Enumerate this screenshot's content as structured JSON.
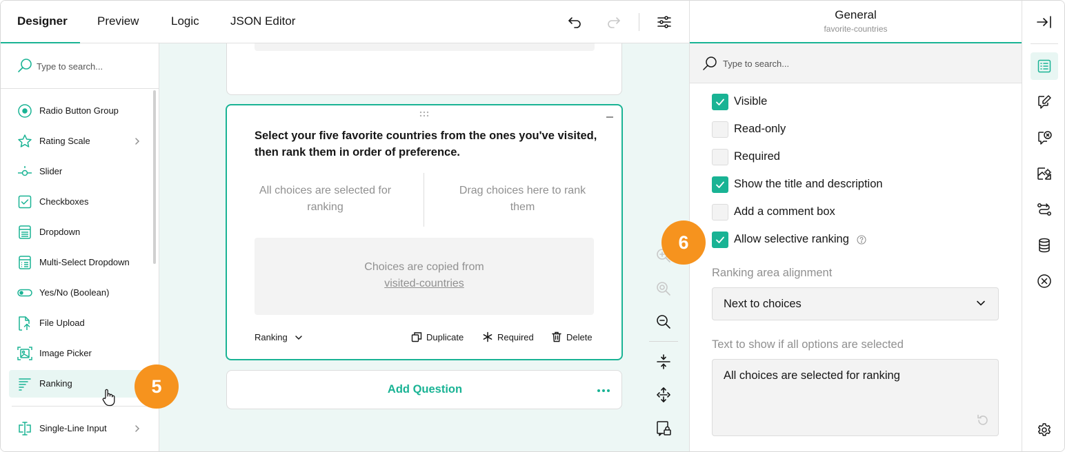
{
  "tabs": [
    {
      "label": "Designer"
    },
    {
      "label": "Preview"
    },
    {
      "label": "Logic"
    },
    {
      "label": "JSON Editor"
    }
  ],
  "toolbar_icons": [
    "undo-icon",
    "redo-icon",
    "settings-sliders-icon"
  ],
  "toolbox": {
    "search_placeholder": "Type to search...",
    "items": [
      {
        "label": "Radio Button Group",
        "icon": "radio-icon"
      },
      {
        "label": "Rating Scale",
        "icon": "star-icon",
        "has_submenu": true
      },
      {
        "label": "Slider",
        "icon": "slider-icon"
      },
      {
        "label": "Checkboxes",
        "icon": "checkbox-icon"
      },
      {
        "label": "Dropdown",
        "icon": "dropdown-icon"
      },
      {
        "label": "Multi-Select Dropdown",
        "icon": "multi-select-icon"
      },
      {
        "label": "Yes/No (Boolean)",
        "icon": "toggle-icon"
      },
      {
        "label": "File Upload",
        "icon": "file-upload-icon"
      },
      {
        "label": "Image Picker",
        "icon": "image-picker-icon"
      },
      {
        "label": "Ranking",
        "icon": "ranking-icon",
        "hovered": true
      },
      {
        "label": "Single-Line Input",
        "icon": "text-input-icon",
        "has_submenu": true
      }
    ]
  },
  "question": {
    "title": "Select your five favorite countries from the ones you've visited, then rank them in order of preference.",
    "left_placeholder": "All choices are selected for ranking",
    "right_placeholder": "Drag choices here to rank them",
    "copied_text": "Choices are copied from",
    "copied_link": "visited-countries",
    "type_label": "Ranking",
    "actions": {
      "duplicate": "Duplicate",
      "required": "Required",
      "delete": "Delete"
    }
  },
  "add_question": {
    "label": "Add Question"
  },
  "property_grid": {
    "title": "General",
    "subtitle": "favorite-countries",
    "search_placeholder": "Type to search...",
    "checkboxes": [
      {
        "label": "Visible",
        "checked": true
      },
      {
        "label": "Read-only",
        "checked": false
      },
      {
        "label": "Required",
        "checked": false
      },
      {
        "label": "Show the title and description",
        "checked": true
      },
      {
        "label": "Add a comment box",
        "checked": false
      },
      {
        "label": "Allow selective ranking",
        "checked": true,
        "help": true
      }
    ],
    "alignment_label": "Ranking area alignment",
    "alignment_value": "Next to choices",
    "all_selected_label": "Text to show if all options are selected",
    "all_selected_value": "All choices are selected for ranking"
  },
  "callouts": {
    "first": "5",
    "second": "6"
  },
  "colors": {
    "accent": "#19b394",
    "callout": "#f6931e",
    "canvas_bg": "#edf7f5"
  }
}
